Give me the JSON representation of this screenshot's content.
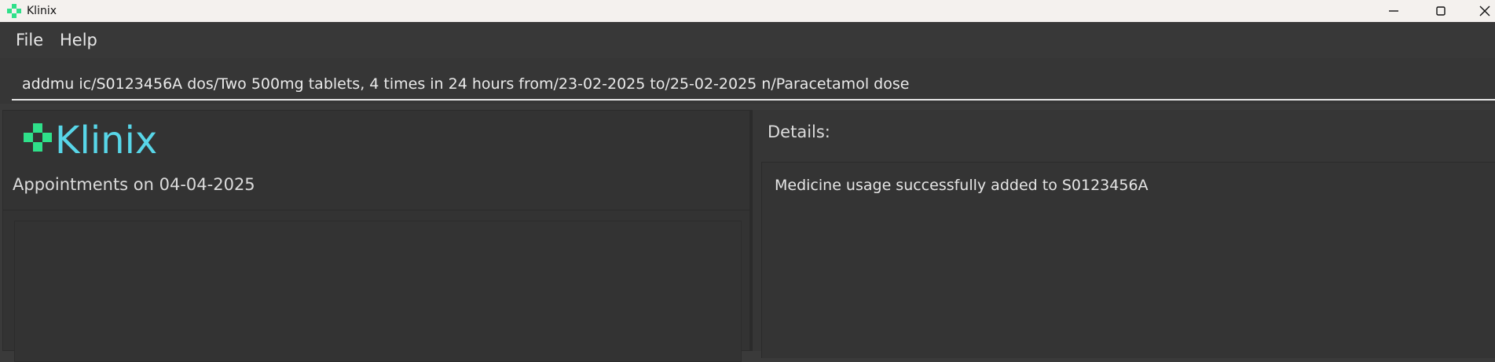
{
  "window": {
    "title": "Klinix",
    "controls": [
      "minimize-icon",
      "maximize-icon",
      "close-icon"
    ]
  },
  "menu": {
    "file_label": "File",
    "help_label": "Help"
  },
  "command": {
    "value": "addmu ic/S0123456A dos/Two 500mg tablets, 4 times in 24 hours from/23-02-2025 to/25-02-2025 n/Paracetamol dose"
  },
  "left": {
    "logo_text": "Klinix",
    "appointments_title": "Appointments on 04-04-2025"
  },
  "right": {
    "details_label": "Details:",
    "result_text": "Medicine usage successfully added to S0123456A"
  },
  "colors": {
    "logo_green": "#2fe08a",
    "logo_cyan": "#58d6e8",
    "background": "#3a3a3a"
  }
}
